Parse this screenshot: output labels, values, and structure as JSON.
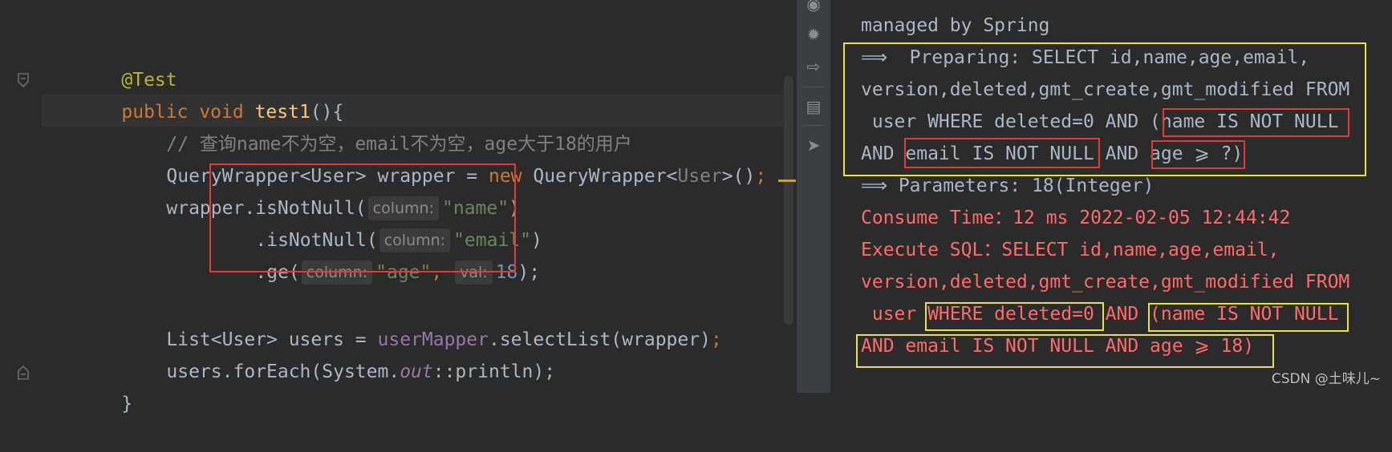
{
  "editor": {
    "lines": {
      "annotation": "@Test",
      "sig_kw": "public void ",
      "sig_fn": "test1",
      "sig_rest": "(){",
      "comment": "// 查询name不为空，email不为空，age大于18的用户",
      "qw_type": "QueryWrapper",
      "qw_generic": "<User>",
      "qw_var": " wrapper = ",
      "qw_new": "new ",
      "qw_ctor": "QueryWrapper<",
      "qw_ctor_generic": "User",
      "qw_ctor_end": ">()",
      "semicolon": ";",
      "w_prefix": "wrapper.",
      "m1": "isNotNull(",
      "m1_arg": "\"name\"",
      "close_paren": ")",
      "m2": ".isNotNull(",
      "m2_arg": "\"email\"",
      "m3": ".ge(",
      "m3_arg": "\"age\"",
      "m3_comma": ", ",
      "m3_num": "18",
      "m3_end": ");",
      "list_type": "List<User> users = ",
      "list_field": "userMapper",
      "list_call": ".selectList(wrapper)",
      "fe_prefix": "users.forEach(System.",
      "fe_out": "out",
      "fe_suffix": "::println);",
      "brace": "}"
    },
    "hints": {
      "column": "column:",
      "val": "val:"
    }
  },
  "console": {
    "line0": "managed by Spring",
    "line1": "⟹  Preparing: SELECT id,name,age,email,",
    "line2": "version,deleted,gmt_create,gmt_modified FROM",
    "line3": " user WHERE deleted=0 AND (name IS NOT NULL",
    "line4": "AND email IS NOT NULL AND age ⩾ ?)",
    "line5": "⟹ Parameters: 18(Integer)",
    "line6": "Consume Time：12 ms 2022-02-05 12:44:42",
    "line7": "Execute SQL：SELECT id,name,age,email,",
    "line8": "version,deleted,gmt_create,gmt_modified FROM",
    "line9": " user WHERE deleted=0 AND (name IS NOT NULL",
    "line10": "AND email IS NOT NULL AND age ⩾ 18)"
  },
  "toolbar": {
    "icons": [
      "camera-icon",
      "bug-icon",
      "login-icon",
      "layout-icon",
      "pin-icon"
    ]
  },
  "watermark": "CSDN @土味儿~",
  "colors": {
    "highlight_red": "#e53935",
    "highlight_yellow": "#e8e23a",
    "log_red": "#ff6b68"
  }
}
